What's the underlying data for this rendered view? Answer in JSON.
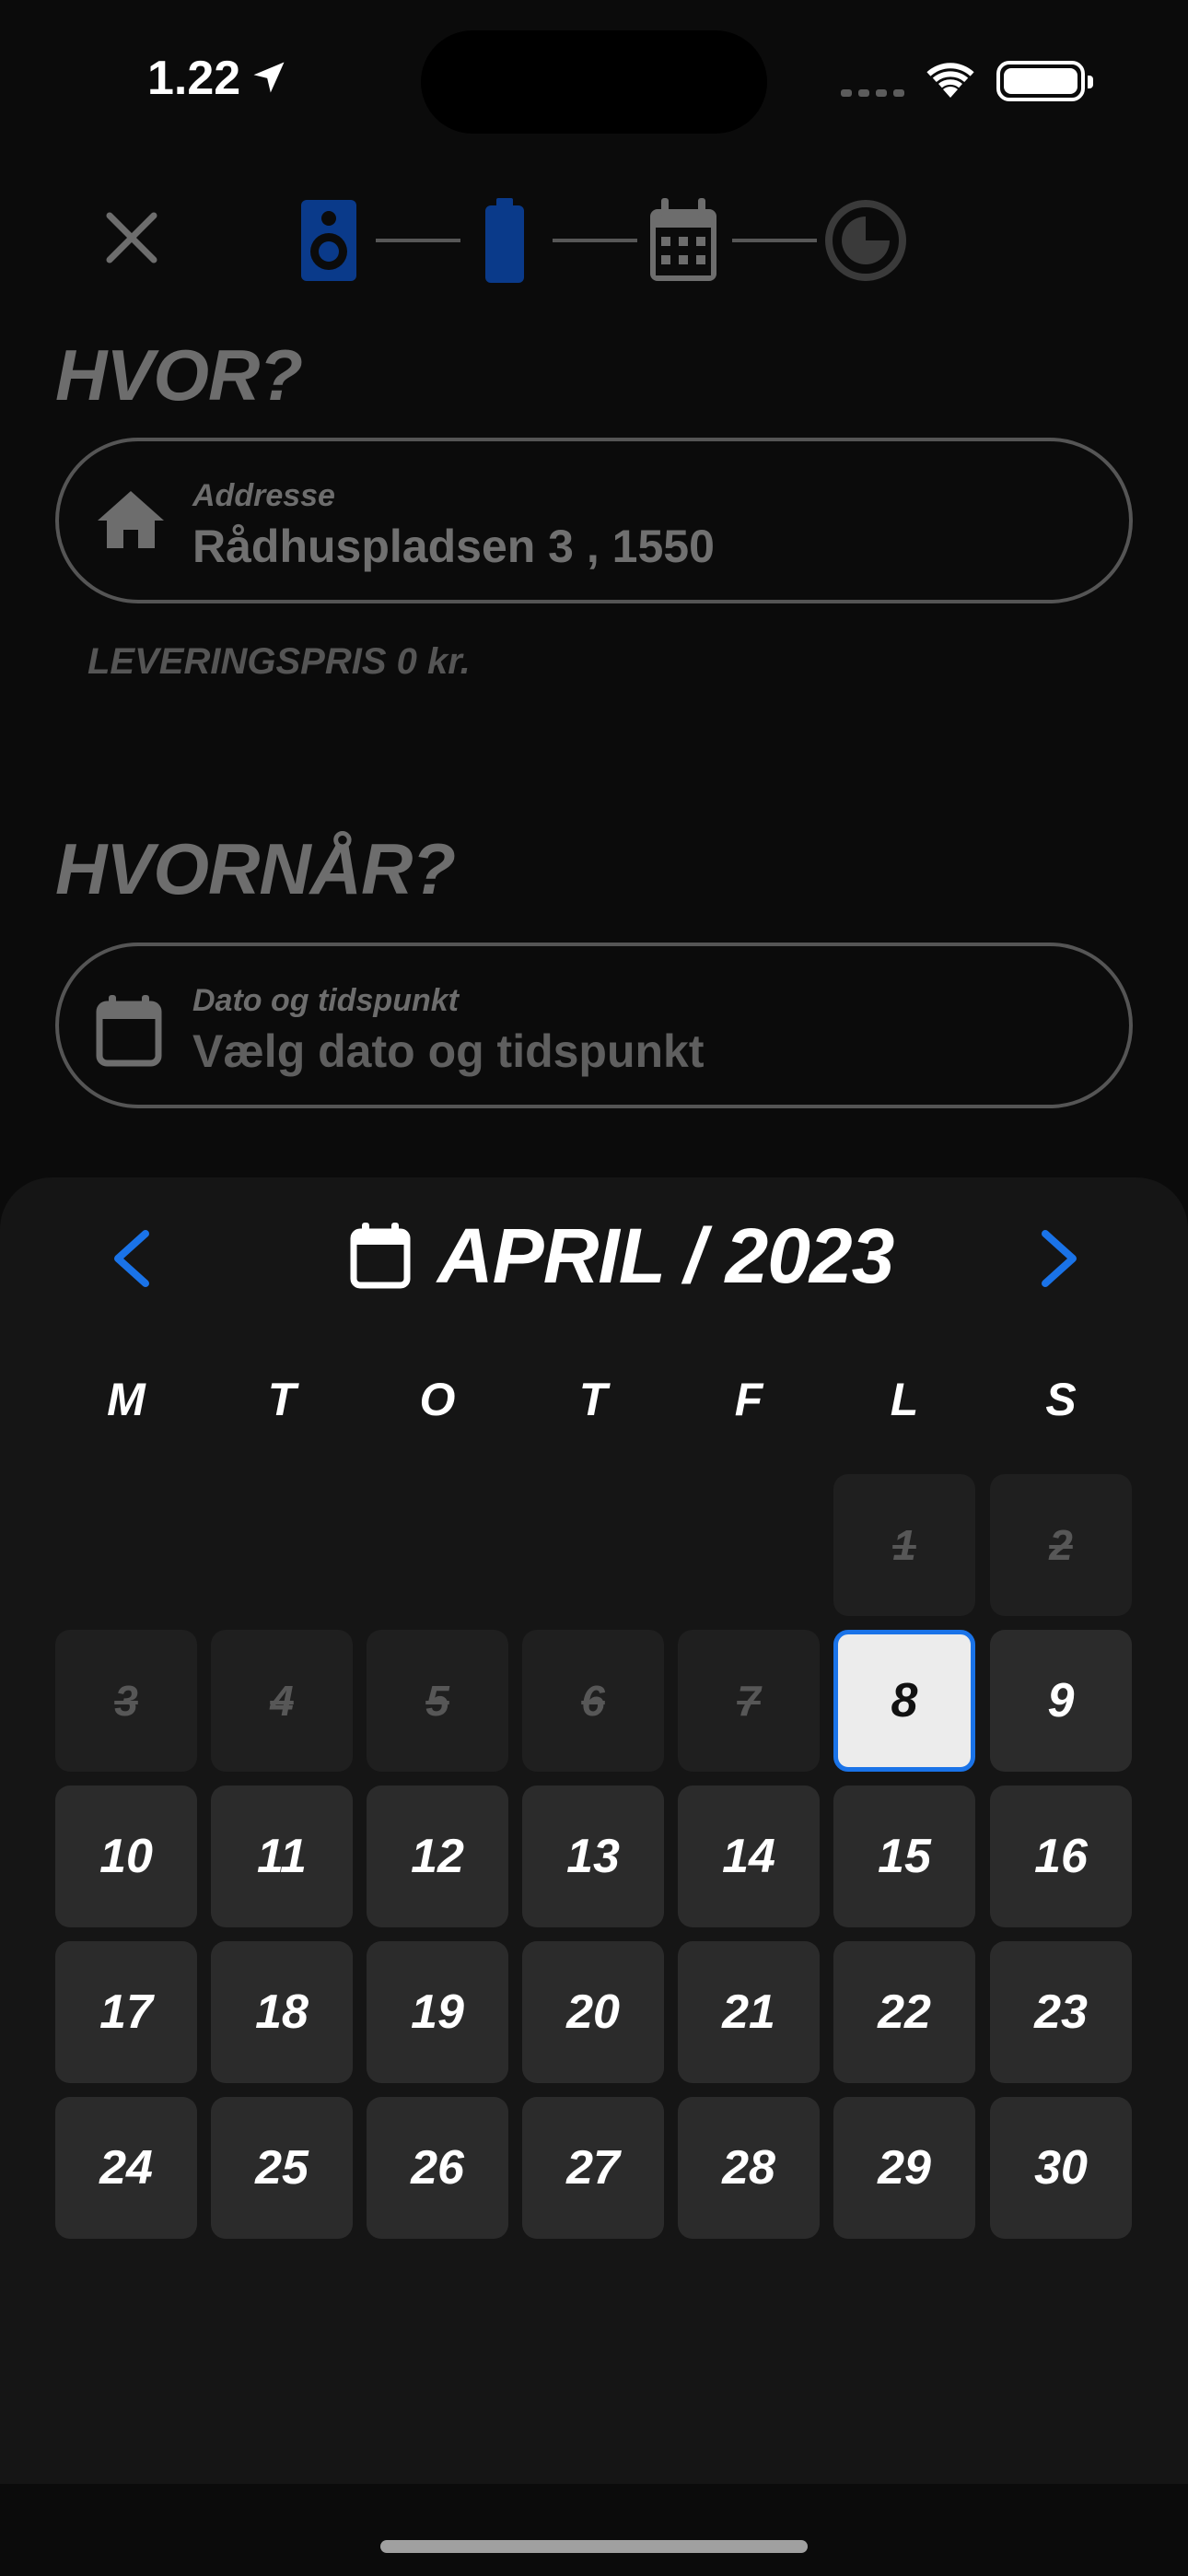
{
  "status": {
    "time": "1.22"
  },
  "progress": {
    "steps": [
      {
        "icon": "speaker-icon",
        "state": "done"
      },
      {
        "icon": "battery-icon",
        "state": "done"
      },
      {
        "icon": "calendar-icon",
        "state": "current"
      },
      {
        "icon": "clock-icon",
        "state": "upcoming"
      }
    ],
    "done_color": "#0a3a8a"
  },
  "where": {
    "title": "HVOR?",
    "address_label": "Addresse",
    "address_value": "Rådhuspladsen 3 , 1550",
    "delivery_price": "LEVERINGSPRIS 0 kr."
  },
  "when": {
    "title": "HVORNÅR?",
    "date_label": "Dato og tidspunkt",
    "date_placeholder": "Vælg dato og tidspunkt"
  },
  "calendar": {
    "month_label": "APRIL / 2023",
    "weekdays": [
      "M",
      "T",
      "O",
      "T",
      "F",
      "L",
      "S"
    ],
    "days": [
      "1",
      "2",
      "3",
      "4",
      "5",
      "6",
      "7",
      "8",
      "9",
      "10",
      "11",
      "12",
      "13",
      "14",
      "15",
      "16",
      "17",
      "18",
      "19",
      "20",
      "21",
      "22",
      "23",
      "24",
      "25",
      "26",
      "27",
      "28",
      "29",
      "30"
    ],
    "disabled_days": [
      "1",
      "2",
      "3",
      "4",
      "5",
      "6",
      "7"
    ],
    "selected_day": "8",
    "accent": "#1a73e8"
  }
}
